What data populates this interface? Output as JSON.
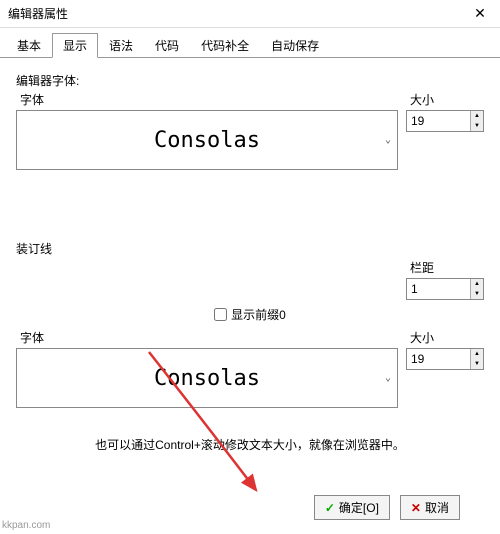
{
  "window": {
    "title": "编辑器属性"
  },
  "tabs": [
    "基本",
    "显示",
    "语法",
    "代码",
    "代码补全",
    "自动保存"
  ],
  "activeTab": 1,
  "editorFont": {
    "section": "编辑器字体:",
    "fontLabel": "字体",
    "sizeLabel": "大小",
    "fontValue": "Consolas",
    "sizeValue": "19"
  },
  "gutter": {
    "section": "装订线",
    "marginLabel": "栏距",
    "marginValue": "1",
    "showPrefix": "显示前缀0",
    "fontLabel": "字体",
    "sizeLabel": "大小",
    "fontValue": "Consolas",
    "sizeValue": "19"
  },
  "hint": "也可以通过Control+滚动修改文本大小，就像在浏览器中。",
  "buttons": {
    "ok": "确定[O]",
    "cancel": "取消"
  },
  "watermark": "kkpan.com"
}
